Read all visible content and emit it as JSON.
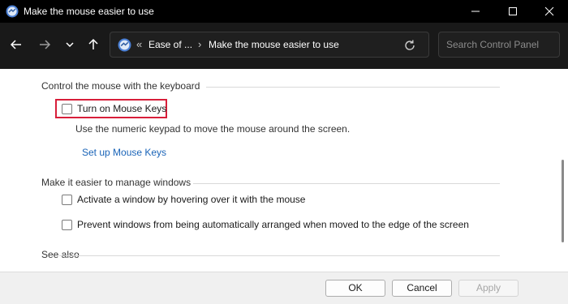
{
  "window": {
    "title": "Make the mouse easier to use"
  },
  "nav": {
    "breadcrumb_chevron": "«",
    "breadcrumb_parent": "Ease of ...",
    "breadcrumb_separator": "›",
    "breadcrumb_current": "Make the mouse easier to use",
    "search_placeholder": "Search Control Panel"
  },
  "sections": {
    "keyboard": {
      "header": "Control the mouse with the keyboard",
      "checkbox_label": "Turn on Mouse Keys",
      "checkbox_checked": false,
      "description": "Use the numeric keypad to move the mouse around the screen.",
      "link": "Set up Mouse Keys"
    },
    "windows": {
      "header": "Make it easier to manage windows",
      "options": [
        {
          "label": "Activate a window by hovering over it with the mouse",
          "checked": false
        },
        {
          "label": "Prevent windows from being automatically arranged when moved to the edge of the screen",
          "checked": false
        }
      ]
    },
    "see_also": {
      "header": "See also"
    }
  },
  "buttons": {
    "ok": "OK",
    "cancel": "Cancel",
    "apply": "Apply"
  },
  "colors": {
    "highlight": "#d81e3a",
    "link": "#1a64b8",
    "titlebar": "#000000"
  }
}
